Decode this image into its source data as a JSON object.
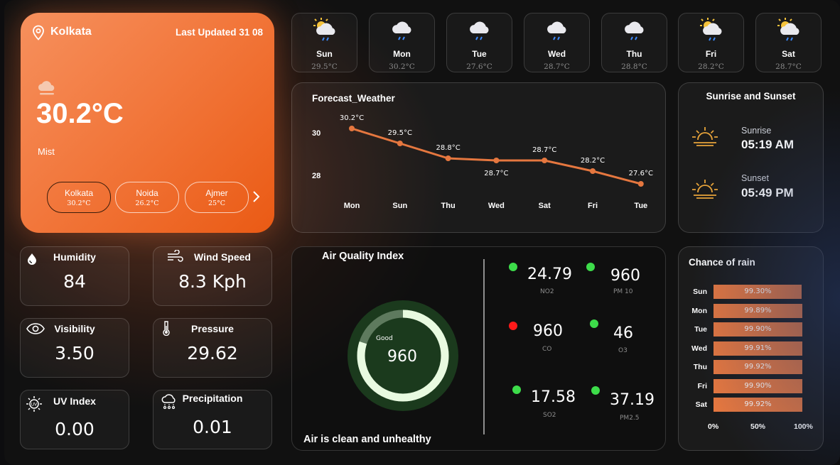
{
  "main": {
    "city": "Kolkata",
    "last_updated": "Last Updated 31 08",
    "temperature": "30.2°C",
    "condition": "Mist",
    "cities": [
      {
        "name": "Kolkata",
        "temp": "30.2°C"
      },
      {
        "name": "Noida",
        "temp": "26.2°C"
      },
      {
        "name": "Ajmer",
        "temp": "25°C"
      }
    ],
    "accent_color": "#f07a3e"
  },
  "days": [
    {
      "name": "Sun",
      "temp": "29.5°C",
      "icon": "partly-cloudy-rain-icon"
    },
    {
      "name": "Mon",
      "temp": "30.2°C",
      "icon": "cloud-rain-icon"
    },
    {
      "name": "Tue",
      "temp": "27.6°C",
      "icon": "cloud-rain-icon"
    },
    {
      "name": "Wed",
      "temp": "28.7°C",
      "icon": "cloud-rain-icon"
    },
    {
      "name": "Thu",
      "temp": "28.8°C",
      "icon": "cloud-rain-icon"
    },
    {
      "name": "Fri",
      "temp": "28.2°C",
      "icon": "partly-cloudy-rain-icon"
    },
    {
      "name": "Sat",
      "temp": "28.7°C",
      "icon": "partly-cloudy-rain-icon"
    }
  ],
  "forecast": {
    "title": "Forecast_Weather"
  },
  "chart_data": {
    "type": "line",
    "title": "Forecast_Weather",
    "categories": [
      "Mon",
      "Sun",
      "Thu",
      "Wed",
      "Sat",
      "Fri",
      "Tue"
    ],
    "series": [
      {
        "values": [
          30.2,
          29.5,
          28.8,
          28.7,
          28.7,
          28.2,
          27.6
        ]
      }
    ],
    "data_labels": [
      "30.2°C",
      "29.5°C",
      "28.8°C",
      "28.7°C",
      "28.7°C",
      "28.2°C",
      "27.6°C"
    ],
    "y_ticks": [
      "30",
      "28"
    ],
    "ylim": [
      27.4,
      30.6
    ],
    "line_color": "#e5773f"
  },
  "sun": {
    "title": "Sunrise and Sunset",
    "sunrise_label": "Sunrise",
    "sunrise_time": "05:19 AM",
    "sunset_label": "Sunset",
    "sunset_time": "05:49 PM",
    "icon_color": "#e7a33a"
  },
  "metrics": {
    "humidity": {
      "label": "Humidity",
      "value": "84"
    },
    "wind": {
      "label": "Wind Speed",
      "value": "8.3 Kph"
    },
    "visibility": {
      "label": "Visibility",
      "value": "3.50"
    },
    "pressure": {
      "label": "Pressure",
      "value": "29.62"
    },
    "uv": {
      "label": "UV Index",
      "value": "0.00"
    },
    "precipitation": {
      "label": "Precipitation",
      "value": "0.01"
    }
  },
  "aqi": {
    "title": "Air Quality Index",
    "gauge_label": "Good",
    "gauge_value": "960",
    "gauge_fraction": 0.8,
    "footer": "Air is clean and unhealthy",
    "pollutants": [
      {
        "value": "24.79",
        "name": "NO2",
        "status_color": "#3ddc4a"
      },
      {
        "value": "960",
        "name": "PM 10",
        "status_color": "#3ddc4a"
      },
      {
        "value": "960",
        "name": "CO",
        "status_color": "#ff1a1a"
      },
      {
        "value": "46",
        "name": "O3",
        "status_color": "#3ddc4a"
      },
      {
        "value": "17.58",
        "name": "SO2",
        "status_color": "#3ddc4a"
      },
      {
        "value": "37.19",
        "name": "PM2.5",
        "status_color": "#3ddc4a"
      }
    ]
  },
  "rain": {
    "title": "Chance of rain",
    "rows": [
      {
        "day": "Sun",
        "value": "99.30%",
        "pct": 99.3
      },
      {
        "day": "Mon",
        "value": "99.89%",
        "pct": 99.89
      },
      {
        "day": "Tue",
        "value": "99.90%",
        "pct": 99.9
      },
      {
        "day": "Wed",
        "value": "99.91%",
        "pct": 99.91
      },
      {
        "day": "Thu",
        "value": "99.92%",
        "pct": 99.92
      },
      {
        "day": "Fri",
        "value": "99.90%",
        "pct": 99.9
      },
      {
        "day": "Sat",
        "value": "99.92%",
        "pct": 99.92
      }
    ],
    "axis": [
      "0%",
      "50%",
      "100%"
    ]
  }
}
